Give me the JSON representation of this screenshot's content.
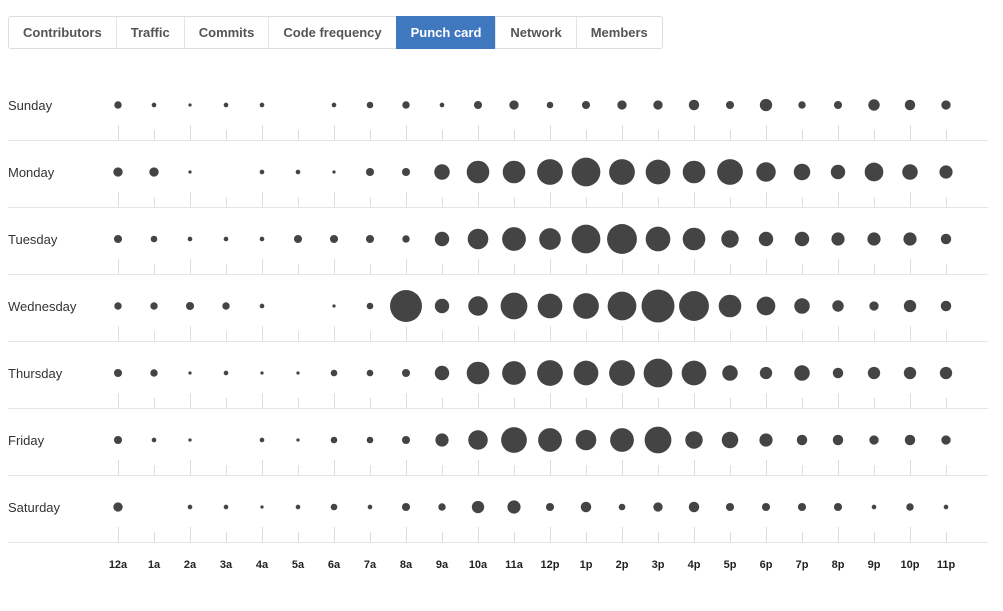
{
  "tabs": [
    {
      "label": "Contributors",
      "active": false
    },
    {
      "label": "Traffic",
      "active": false
    },
    {
      "label": "Commits",
      "active": false
    },
    {
      "label": "Code frequency",
      "active": false
    },
    {
      "label": "Punch card",
      "active": true
    },
    {
      "label": "Network",
      "active": false
    },
    {
      "label": "Members",
      "active": false
    }
  ],
  "colors": {
    "accent": "#4078c0",
    "dot": "#444444",
    "gridline": "#e5e5e5",
    "tick": "#dddddd"
  },
  "chart_data": {
    "type": "scatter",
    "title": "Punch card",
    "xlabel": "",
    "ylabel": "",
    "encoding": "dot area proportional to commit count",
    "days": [
      "Sunday",
      "Monday",
      "Tuesday",
      "Wednesday",
      "Thursday",
      "Friday",
      "Saturday"
    ],
    "hours": [
      "12a",
      "1a",
      "2a",
      "3a",
      "4a",
      "5a",
      "6a",
      "7a",
      "8a",
      "9a",
      "10a",
      "11a",
      "12p",
      "1p",
      "2p",
      "3p",
      "4p",
      "5p",
      "6p",
      "7p",
      "8p",
      "9p",
      "10p",
      "11p"
    ],
    "values": [
      [
        5,
        2,
        1,
        2,
        2,
        0,
        2,
        4,
        5,
        2,
        6,
        8,
        4,
        6,
        8,
        8,
        10,
        6,
        14,
        5,
        6,
        12,
        10,
        8
      ],
      [
        8,
        8,
        1,
        0,
        2,
        2,
        1,
        6,
        6,
        22,
        47,
        47,
        61,
        76,
        61,
        56,
        47,
        61,
        35,
        25,
        19,
        32,
        22,
        16
      ],
      [
        6,
        4,
        2,
        2,
        2,
        6,
        6,
        6,
        5,
        19,
        39,
        52,
        43,
        76,
        82,
        56,
        47,
        28,
        19,
        19,
        16,
        16,
        16,
        10
      ],
      [
        5,
        5,
        6,
        5,
        2,
        0,
        1,
        4,
        94,
        19,
        35,
        66,
        56,
        61,
        76,
        100,
        82,
        47,
        32,
        22,
        12,
        8,
        14,
        10
      ],
      [
        6,
        5,
        1,
        2,
        1,
        1,
        4,
        4,
        6,
        19,
        47,
        52,
        61,
        56,
        61,
        76,
        56,
        22,
        14,
        22,
        10,
        14,
        14,
        14
      ],
      [
        6,
        2,
        1,
        0,
        2,
        1,
        4,
        4,
        6,
        16,
        35,
        61,
        52,
        39,
        52,
        66,
        28,
        25,
        16,
        10,
        10,
        8,
        10,
        8
      ],
      [
        8,
        0,
        2,
        2,
        1,
        2,
        4,
        2,
        6,
        5,
        14,
        16,
        6,
        10,
        4,
        8,
        10,
        6,
        6,
        6,
        6,
        2,
        5,
        2
      ]
    ],
    "max_value": 100,
    "grid": true,
    "legend": "none"
  }
}
